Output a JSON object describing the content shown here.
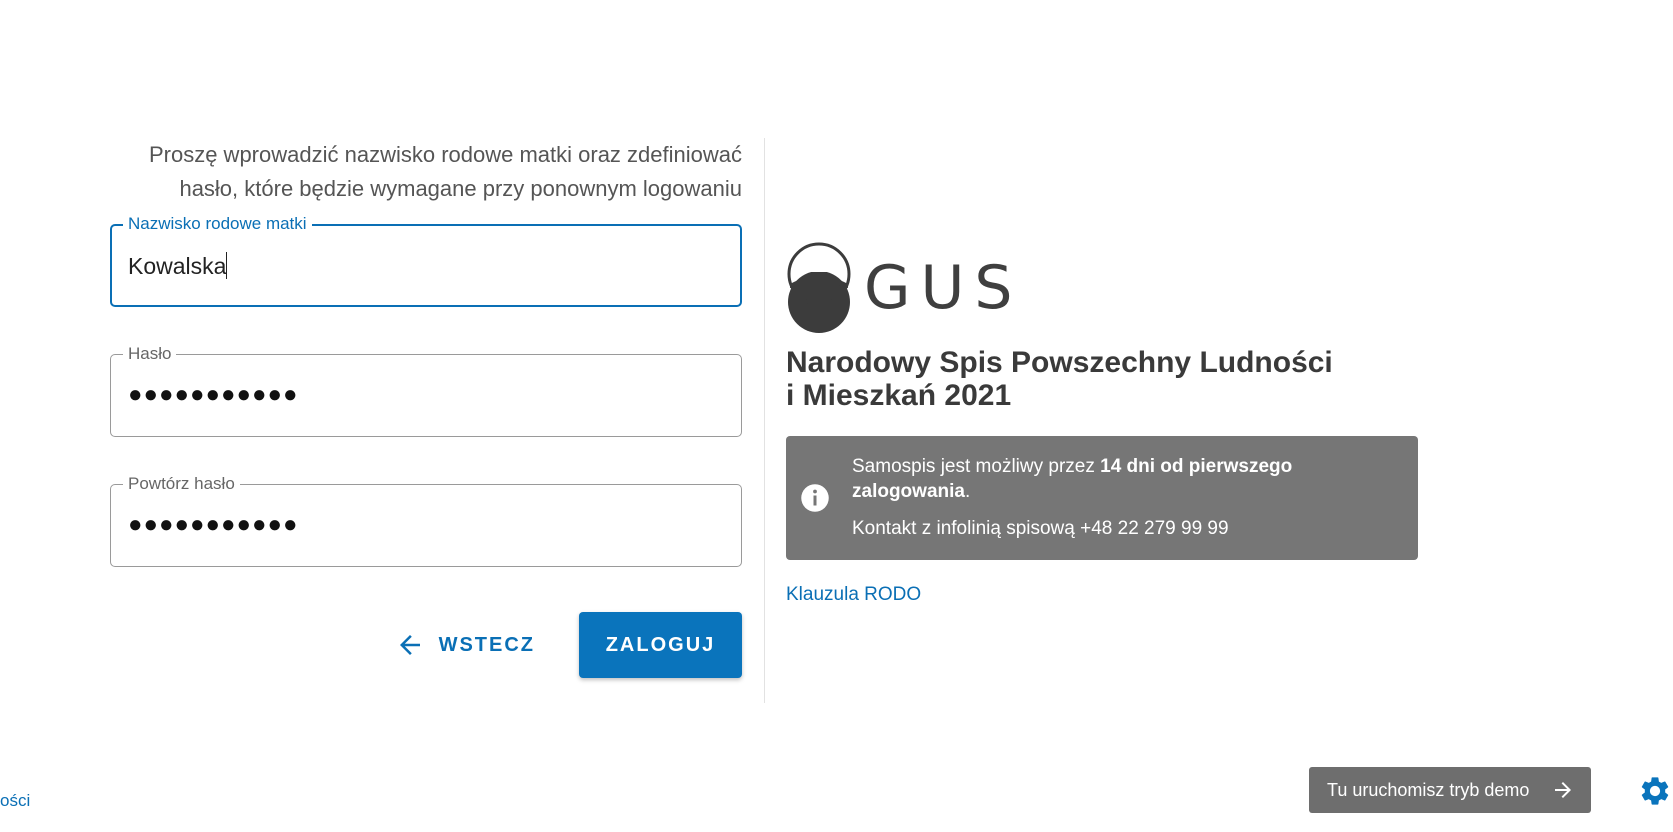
{
  "form": {
    "instruction_line1": "Proszę wprowadzić nazwisko rodowe matki oraz zdefiniować",
    "instruction_line2": "hasło, które będzie wymagane przy ponownym logowaniu",
    "maiden_name": {
      "label": "Nazwisko rodowe matki",
      "value": "Kowalska"
    },
    "password": {
      "label": "Hasło",
      "value": "●●●●●●●●●●●"
    },
    "password_repeat": {
      "label": "Powtórz hasło",
      "value": "●●●●●●●●●●●"
    },
    "back_label": "WSTECZ",
    "login_label": "ZALOGUJ"
  },
  "info": {
    "logo_text": "GUS",
    "title": "Narodowy Spis Powszechny Ludności i Mieszkań 2021",
    "notice_prefix": "Samospis jest możliwy przez ",
    "notice_bold": "14 dni od pierwszego zalogowania",
    "notice_suffix": ".",
    "contact": "Kontakt z infolinią spisową +48 22 279 99 99",
    "rodo_link": "Klauzula RODO"
  },
  "footer": {
    "left_link_fragment": "ości",
    "demo_label": "Tu uruchomisz tryb demo"
  },
  "colors": {
    "accent": "#0a74bc",
    "notice_bg": "#767676",
    "demo_bg": "#6e6e6e"
  },
  "icons": {
    "back": "arrow-left-icon",
    "info": "info-icon",
    "demo": "arrow-right-icon",
    "settings": "gear-icon",
    "logo": "gus-logo"
  }
}
